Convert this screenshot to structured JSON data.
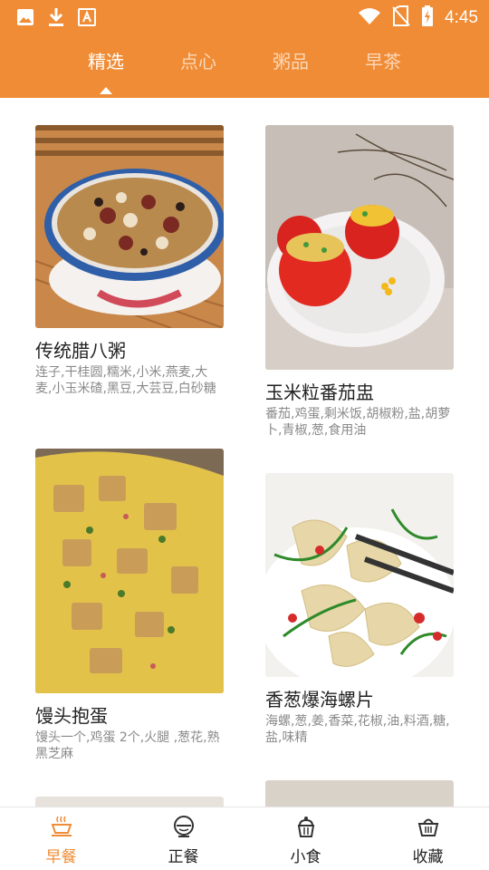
{
  "status_bar": {
    "time": "4:45",
    "left_icons": [
      "image-icon",
      "download-icon",
      "text-a-icon"
    ],
    "right_icons": [
      "wifi-icon",
      "no-sim-icon",
      "battery-charging-icon"
    ]
  },
  "tabs": [
    {
      "label": "精选",
      "active": true
    },
    {
      "label": "点心",
      "active": false
    },
    {
      "label": "粥品",
      "active": false
    },
    {
      "label": "早茶",
      "active": false
    }
  ],
  "recipes": [
    {
      "title": "传统腊八粥",
      "ingredients": "连子,干桂圆,糯米,小米,燕麦,大麦,小玉米碴,黑豆,大芸豆,白砂糖"
    },
    {
      "title": "玉米粒番茄盅",
      "ingredients": "番茄,鸡蛋,剩米饭,胡椒粉,盐,胡萝卜,青椒,葱,食用油"
    },
    {
      "title": "馒头抱蛋",
      "ingredients": "馒头一个,鸡蛋 2个,火腿 ,葱花,熟黑芝麻"
    },
    {
      "title": "香葱爆海螺片",
      "ingredients": "海螺,葱,姜,香菜,花椒,油,料酒,糖,盐,味精"
    }
  ],
  "bottom_nav": [
    {
      "label": "早餐",
      "icon": "coffee-cup-icon",
      "active": true
    },
    {
      "label": "正餐",
      "icon": "rice-bowl-icon",
      "active": false
    },
    {
      "label": "小食",
      "icon": "cupcake-icon",
      "active": false
    },
    {
      "label": "收藏",
      "icon": "basket-icon",
      "active": false
    }
  ],
  "colors": {
    "primary": "#F08C35",
    "text": "#222222",
    "subtext": "#8A8A8A"
  }
}
